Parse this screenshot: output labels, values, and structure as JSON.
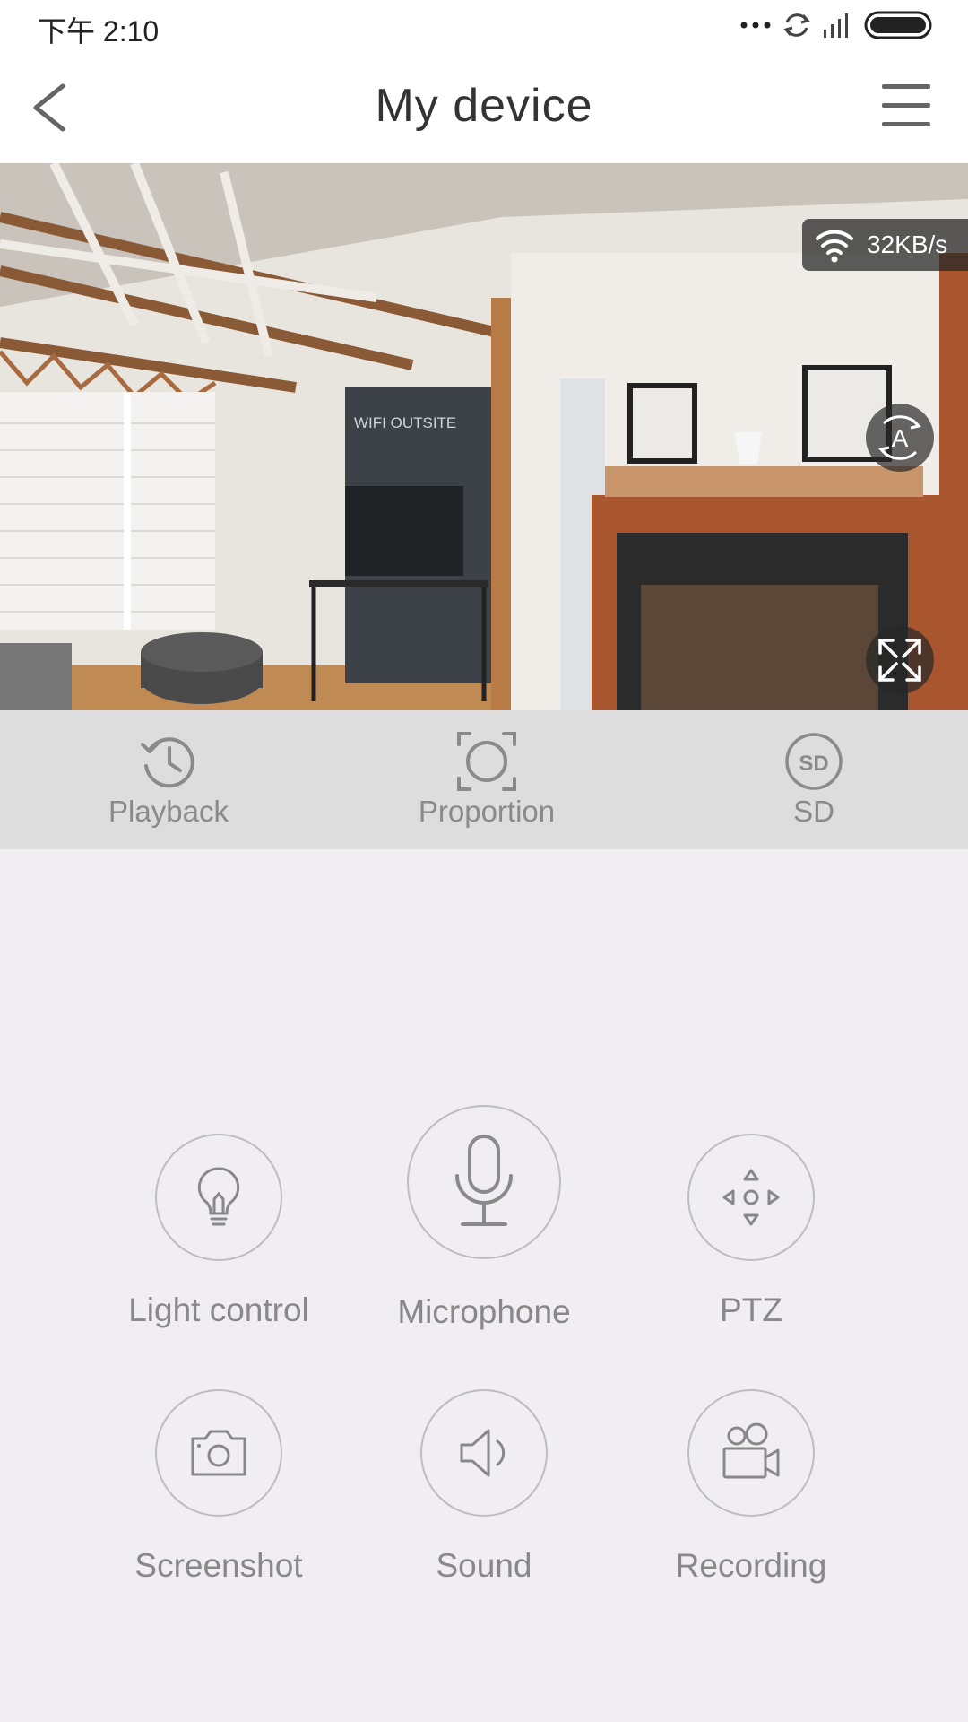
{
  "status_bar": {
    "time": "下午 2:10",
    "icons": [
      "more-dots-icon",
      "sync-icon",
      "signal-icon",
      "battery-icon"
    ]
  },
  "header": {
    "title": "My device",
    "back_icon": "chevron-left-icon",
    "menu_icon": "hamburger-menu-icon"
  },
  "video": {
    "speed": "32KB/s",
    "speed_icon": "wifi-icon",
    "auto_icon": "auto-rotate-icon",
    "auto_letter": "A",
    "fullscreen_icon": "fullscreen-expand-icon",
    "sign_title": "WIFI OUTSITE"
  },
  "quick_actions": [
    {
      "label": "Playback",
      "icon": "history-clock-icon"
    },
    {
      "label": "Proportion",
      "icon": "aspect-ratio-icon"
    },
    {
      "label": "SD",
      "icon": "sd-card-icon",
      "badge": "SD"
    }
  ],
  "controls": [
    {
      "label": "Light control",
      "icon": "lightbulb-icon"
    },
    {
      "label": "Microphone",
      "icon": "microphone-icon"
    },
    {
      "label": "PTZ",
      "icon": "ptz-direction-icon"
    },
    {
      "label": "Screenshot",
      "icon": "camera-icon"
    },
    {
      "label": "Sound",
      "icon": "speaker-icon"
    },
    {
      "label": "Recording",
      "icon": "video-camera-icon"
    }
  ],
  "colors": {
    "header_bg": "#ffffff",
    "page_bg": "#f0eef2",
    "quick_bar_bg": "#dedddd",
    "icon_gray": "#8a8a8a",
    "circle_border": "#bdbdbd"
  }
}
